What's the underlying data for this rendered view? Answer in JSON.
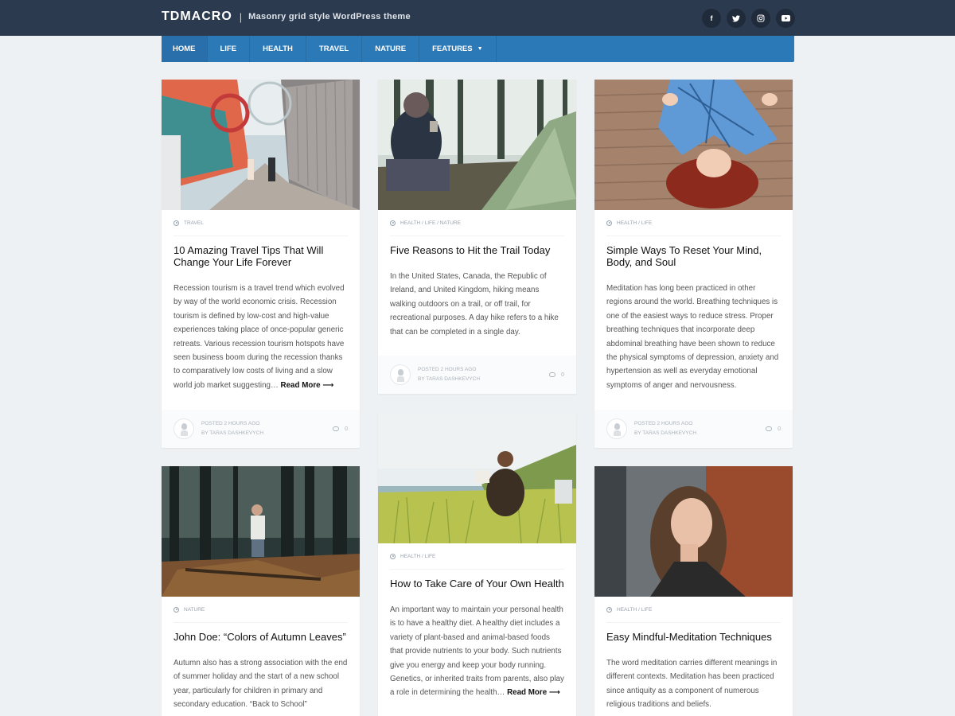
{
  "brand": {
    "title": "TDMACRO",
    "separator": "|",
    "tagline": "Masonry grid style WordPress theme"
  },
  "socials": [
    {
      "icon": "facebook-icon",
      "glyph": "f"
    },
    {
      "icon": "twitter-icon",
      "glyph": "t"
    },
    {
      "icon": "instagram-icon",
      "glyph": "◎"
    },
    {
      "icon": "youtube-icon",
      "glyph": "▶"
    }
  ],
  "nav": {
    "home": "HOME",
    "life": "LIFE",
    "health": "HEALTH",
    "travel": "TRAVEL",
    "nature": "NATURE",
    "features": "FEATURES"
  },
  "posts": [
    {
      "category": "TRAVEL",
      "title": "10 Amazing Travel Tips That Will Change Your Life Forever",
      "excerpt": "Recession tourism is a travel trend which evolved by way of the world economic crisis. Recession tourism is defined by low-cost and high-value experiences taking place of once-popular generic retreats. Various recession tourism hotspots have seen business boom during the recession thanks to comparatively low costs of living and a slow world job market suggesting…",
      "read_more": "Read More ⟶",
      "posted": "POSTED 2 HOURS AGO",
      "author": "BY TARAS DASHKEVYCH",
      "comments": "0"
    },
    {
      "category": "HEALTH / LIFE / NATURE",
      "title": "Five Reasons to Hit the Trail Today",
      "excerpt": "In the United States, Canada, the Republic of Ireland, and United Kingdom, hiking means walking outdoors on a trail, or off trail, for recreational purposes. A day hike refers to a hike that can be completed in a single day.",
      "posted": "POSTED 2 HOURS AGO",
      "author": "BY TARAS DASHKEVYCH",
      "comments": "0"
    },
    {
      "category": "HEALTH / LIFE",
      "title": "Simple Ways To Reset Your Mind, Body, and Soul",
      "excerpt": "Meditation has long been practiced in other regions around the world. Breathing techniques is one of the easiest ways to reduce stress. Proper breathing techniques that incorporate deep abdominal breathing have been shown to reduce the physical symptoms of depression, anxiety and hypertension as well as everyday emotional symptoms of anger and nervousness.",
      "posted": "POSTED 2 HOURS AGO",
      "author": "BY TARAS DASHKEVYCH",
      "comments": "0"
    },
    {
      "category": "NATURE",
      "title": "John Doe: “Colors of Autumn Leaves”",
      "excerpt": "Autumn also has a strong association with the end of summer holiday and the start of a new school year, particularly for children in primary and secondary education. “Back to School”"
    },
    {
      "category": "HEALTH / LIFE",
      "title": "How to Take Care of Your Own Health",
      "excerpt": "An important way to maintain your personal health is to have a healthy diet. A healthy diet includes a variety of plant-based and animal-based foods that provide nutrients to your body. Such nutrients give you energy and keep your body running. Genetics, or inherited traits from parents, also play a role in determining the health…",
      "read_more": "Read More ⟶"
    },
    {
      "category": "HEALTH / LIFE",
      "title": "Easy Mindful-Meditation Techniques",
      "excerpt": "The word meditation carries different meanings in different contexts. Meditation has been practiced since antiquity as a component of numerous religious traditions and beliefs."
    }
  ]
}
